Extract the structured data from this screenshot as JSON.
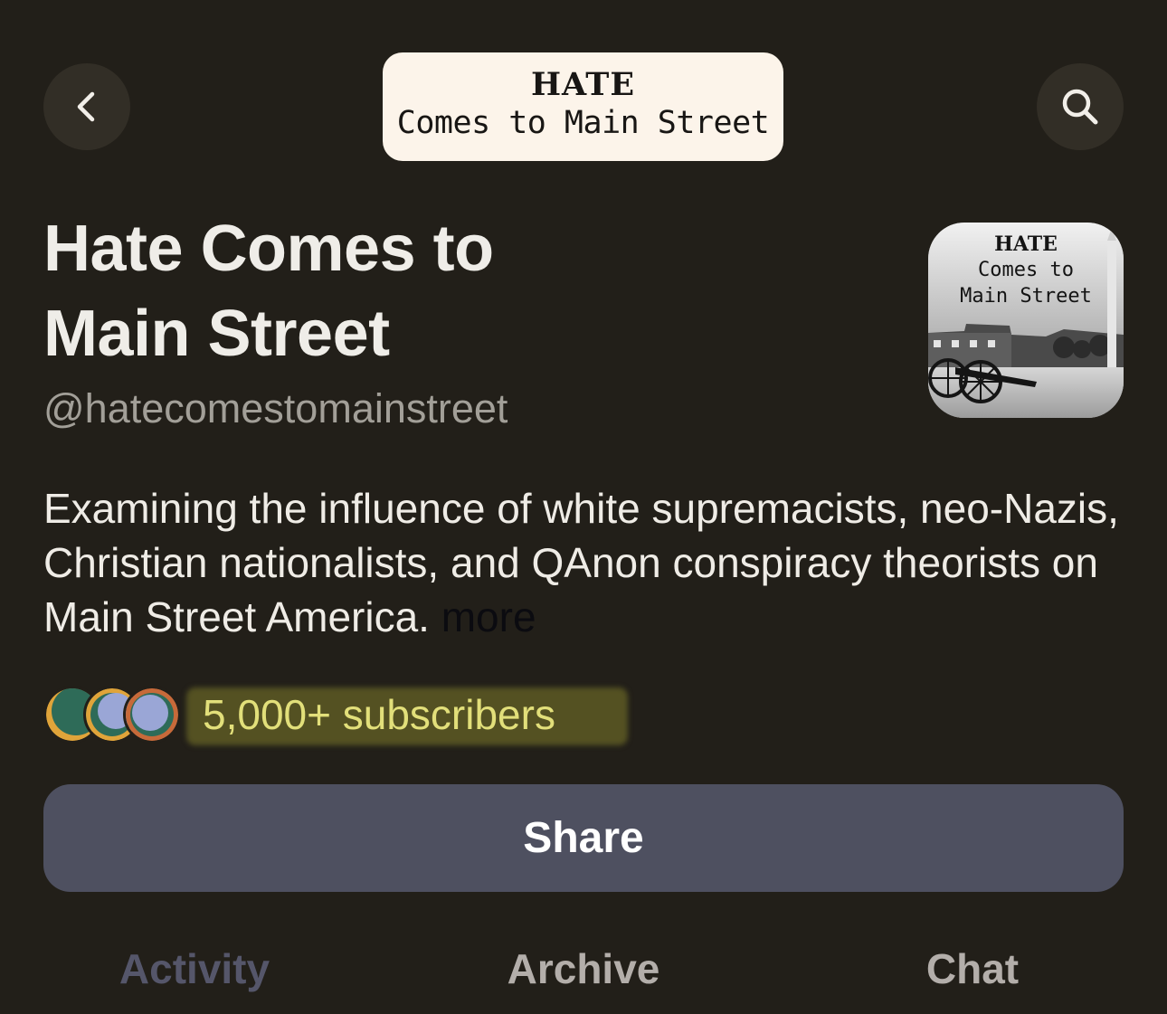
{
  "header": {
    "back_icon": "chevron-left-icon",
    "search_icon": "search-icon",
    "logo": {
      "line1": "HATE",
      "line2": "Comes to Main Street"
    }
  },
  "publication": {
    "title": "Hate Comes to Main Street",
    "handle": "@hatecomestomainstreet",
    "cover": {
      "line1": "HATE",
      "line2": "Comes to\nMain Street"
    },
    "description": "Examining the influence of white supremacists, neo-Nazis, Christian nationalists, and QAnon conspiracy theorists on Main Street America.",
    "more_label": "more",
    "subscribers_label": "5,000+ subscribers"
  },
  "share_label": "Share",
  "tabs": [
    {
      "label": "Activity",
      "active": true
    },
    {
      "label": "Archive",
      "active": false
    },
    {
      "label": "Chat",
      "active": false
    }
  ],
  "colors": {
    "background": "#221f19",
    "button": "#4e5060",
    "highlight": "#545122",
    "subscribers_text": "#e2df7a",
    "active_tab": "#55566a"
  }
}
